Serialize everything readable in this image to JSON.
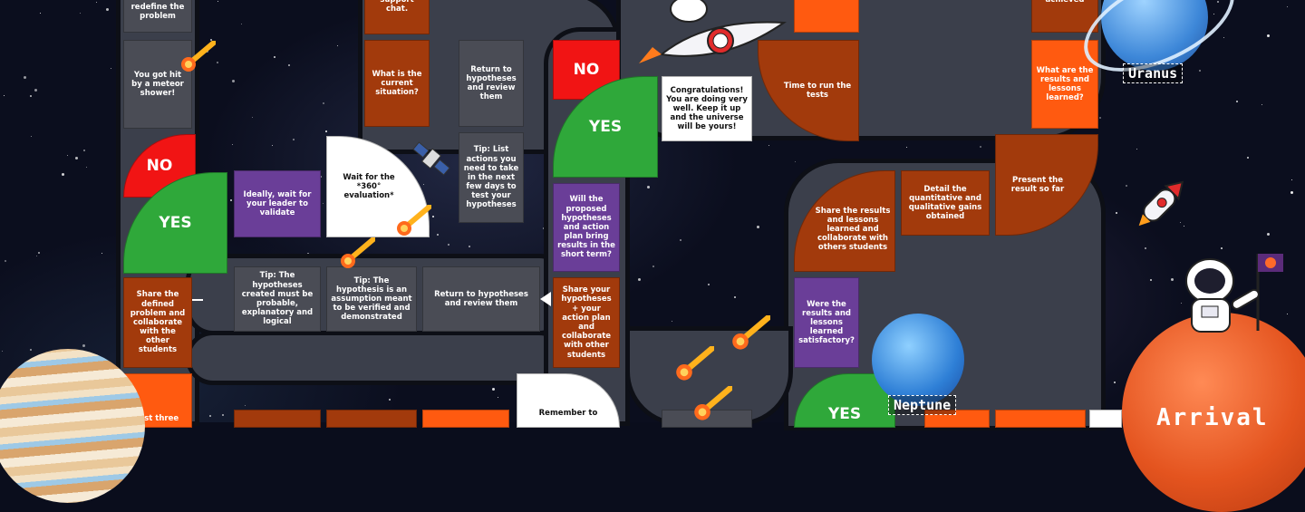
{
  "colors": {
    "rust": "#a23a0c",
    "orange": "#ff5a10",
    "purple": "#6a3e98",
    "gray": "#4a4c55",
    "red": "#f11414",
    "green": "#2fa83a",
    "track": "#3b3f4b"
  },
  "cells": {
    "redefine": "redefine the problem",
    "meteor_shower": "You got hit by a meteor shower!",
    "no_left": "NO",
    "yes_left": "YES",
    "share_defined": "Share the defined problem and collaborate with the other students",
    "list_three": "List three",
    "support_chat": "support chat.",
    "current_situation": "What is the current situation?",
    "wait_leader": "Ideally, wait for your leader to validate",
    "wait_360": "Wait for the *360° evaluation*",
    "tip_probable": "Tip: The hypotheses created must be probable, explanatory and logical",
    "tip_assumption": "Tip: The hypothesis is an assumption meant to be verified and demonstrated",
    "return_review_top": "Return to hypotheses and review them",
    "tip_list_actions": "Tip: List actions you need to take in the next few days to test your hypotheses",
    "return_review_mid": "Return to hypotheses and review them",
    "remember_to": "Remember to",
    "no_mid": "NO",
    "yes_mid": "YES",
    "will_hypotheses": "Will the proposed hypotheses and action plan bring results in the short term?",
    "share_hypotheses": "Share your hypotheses + your action plan and collaborate with other students",
    "congrats": "Congratulations! You are doing very well. Keep it up and the universe will be yours!",
    "run_tests": "Time to run the tests",
    "share_results": "Share the results and lessons learned and collaborate with others students",
    "were_satisfactory": "Were the results and lessons learned satisfactory?",
    "yes_bottom": "YES",
    "detail_gains": "Detail the quantitative and qualitative gains obtained",
    "present_result": "Present the result so far",
    "achieved": "achieved",
    "results_lessons": "What are the results and lessons learned?"
  },
  "planets": {
    "uranus": "Uranus",
    "neptune": "Neptune",
    "arrival": "Arrival"
  }
}
